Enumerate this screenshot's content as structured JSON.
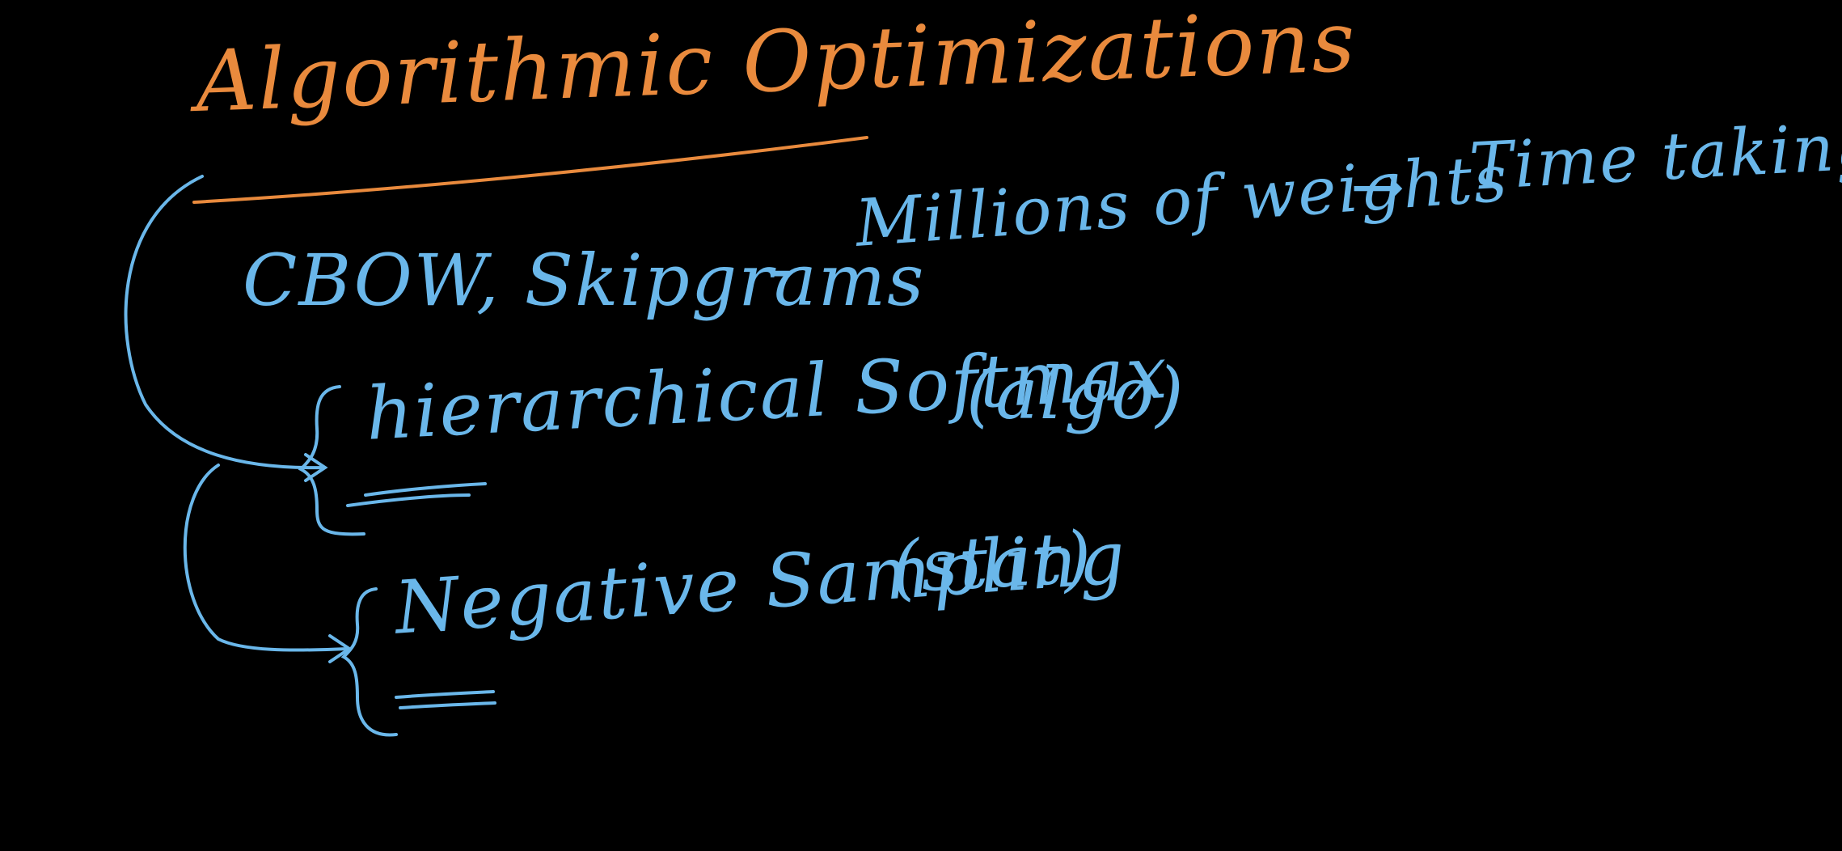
{
  "colors": {
    "background": "#000000",
    "heading_ink": "#e98a3d",
    "body_ink": "#6ab7ea"
  },
  "heading": {
    "text": "Algorithmic Optimizations"
  },
  "line1": {
    "models": "CBOW, Skipgrams",
    "dash": "-",
    "problem": "Millions of weights",
    "arrow": "→",
    "result": "Time taking"
  },
  "methods": [
    {
      "name": "hierarchical Softmax",
      "tag": "(algo)"
    },
    {
      "name": "Negative Sampling",
      "tag": "(stat)"
    }
  ]
}
